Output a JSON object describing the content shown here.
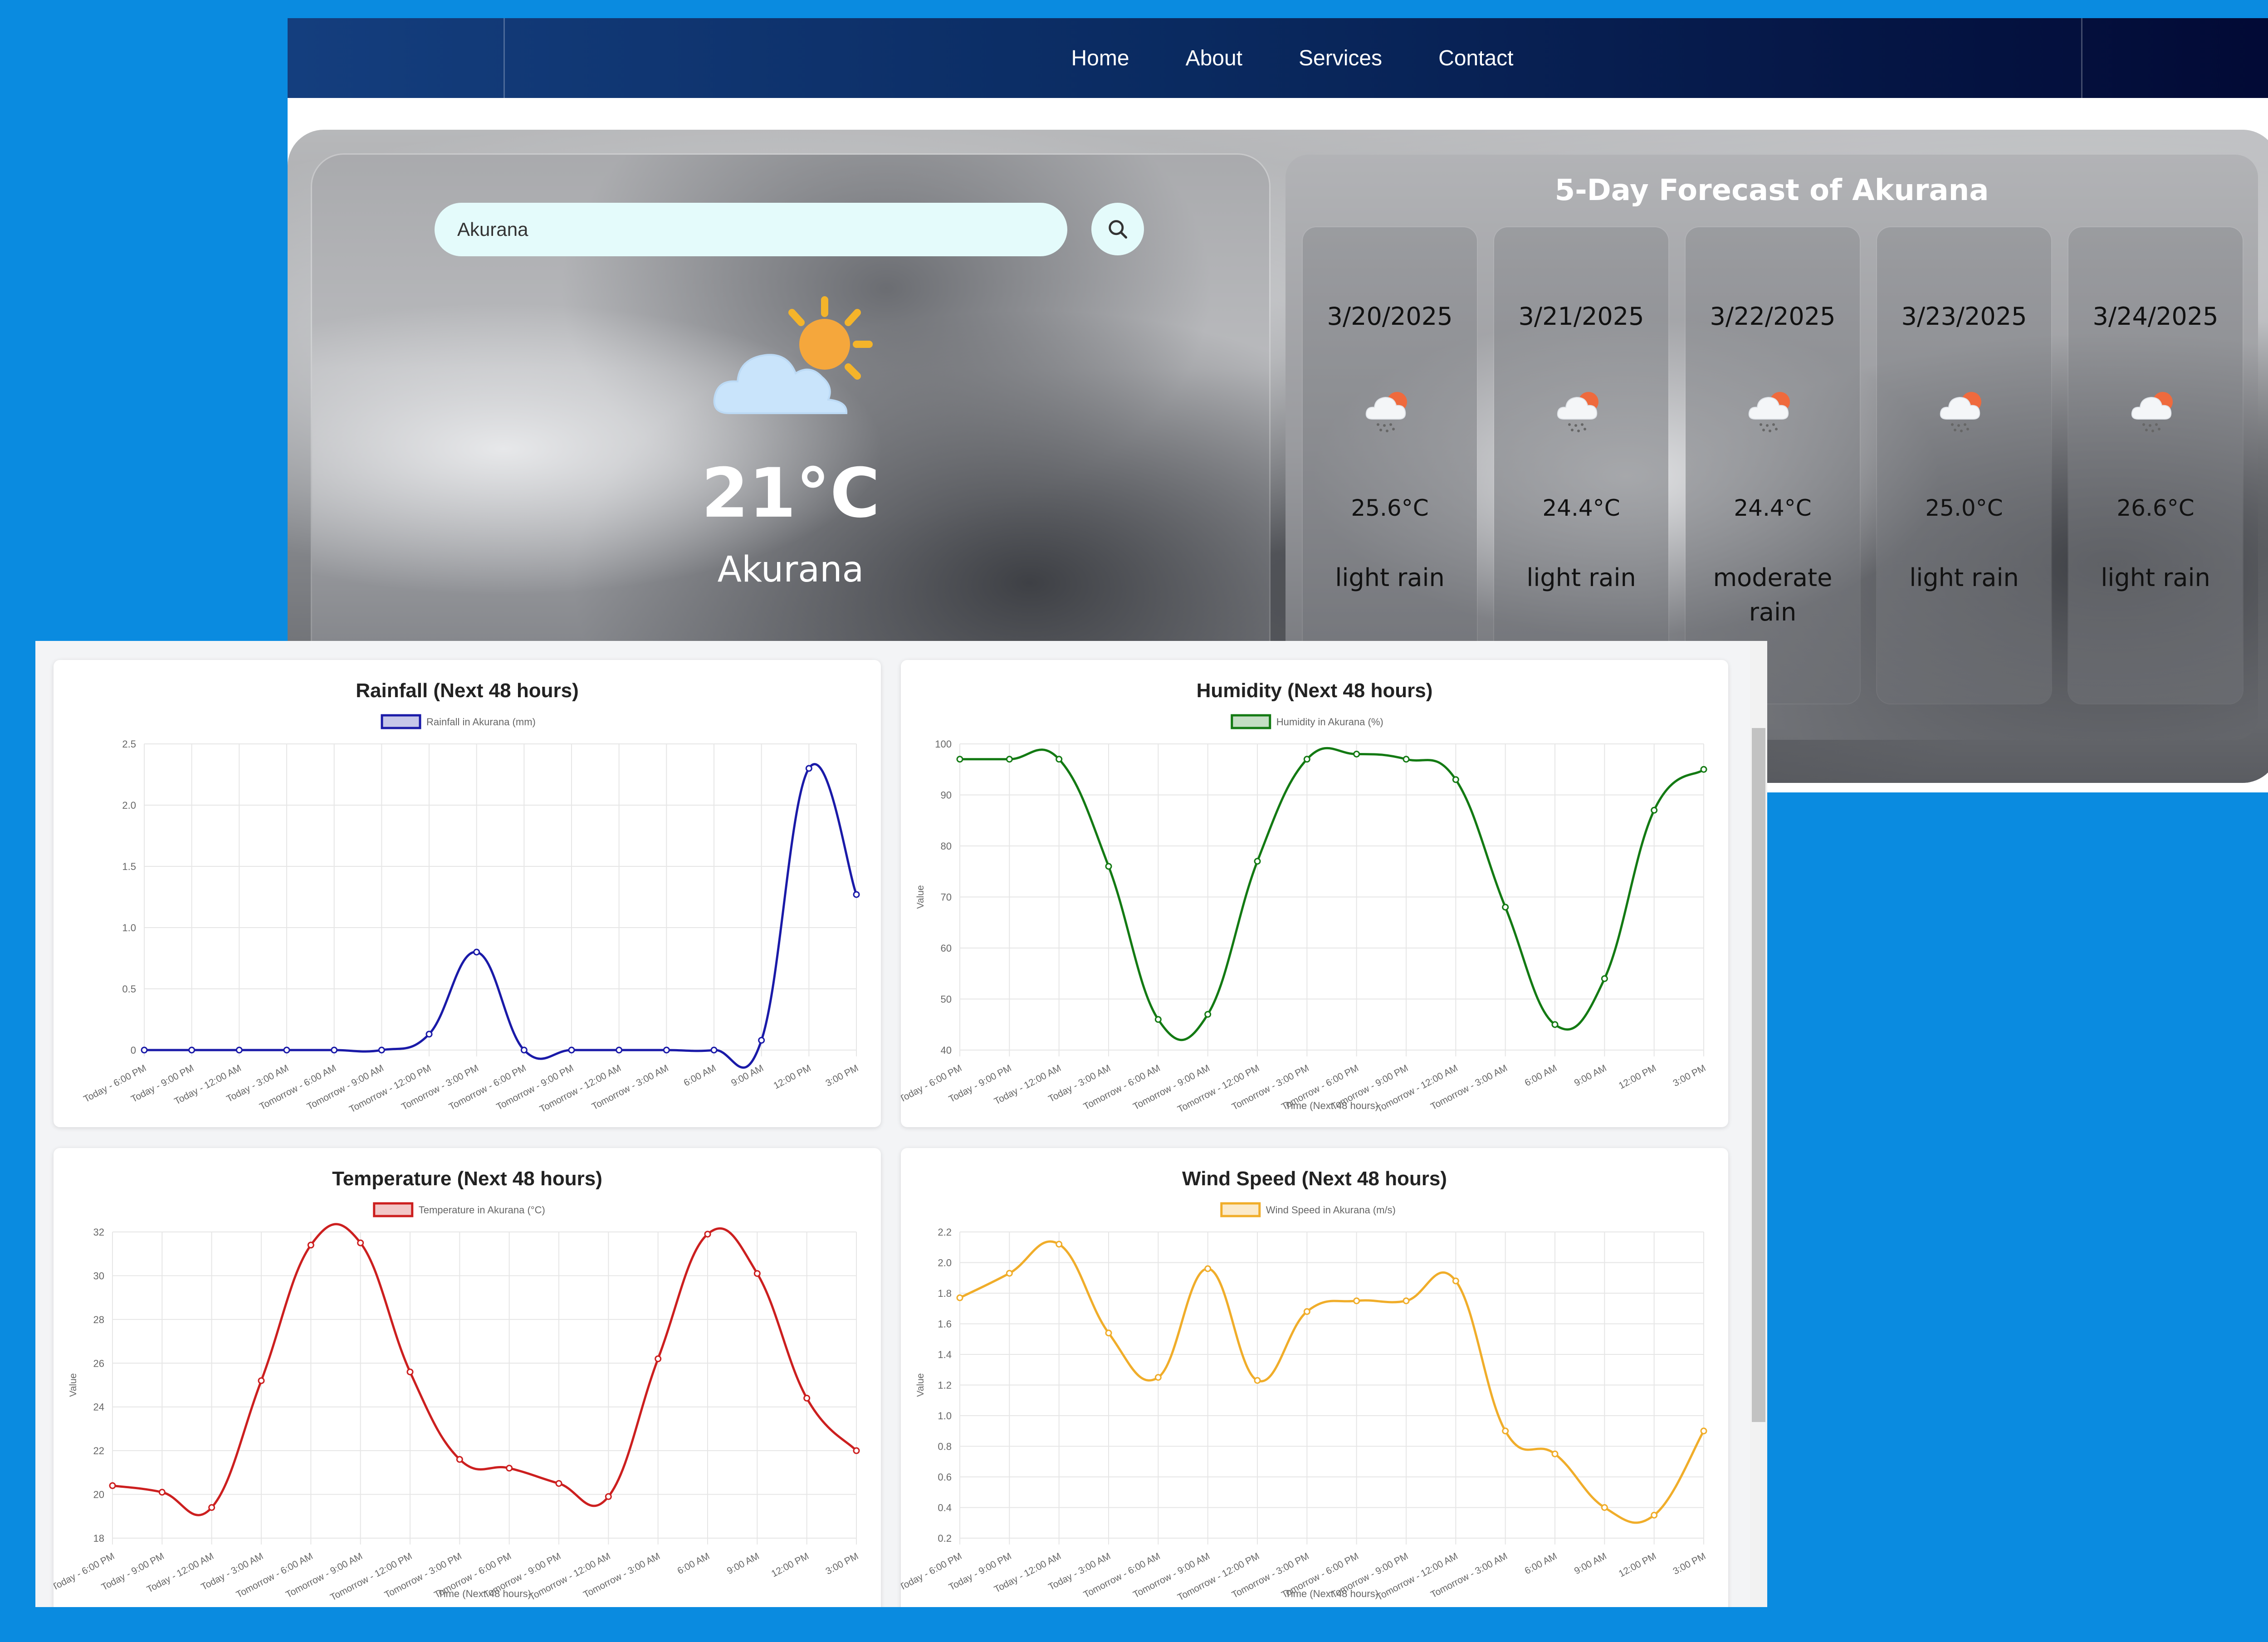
{
  "nav": {
    "links": [
      "Home",
      "About",
      "Services",
      "Contact"
    ]
  },
  "search": {
    "value": "Akurana"
  },
  "current": {
    "temperature": "21°C",
    "city": "Akurana",
    "icon": "sun-behind-cloud-icon"
  },
  "forecast": {
    "title": "5-Day Forecast of Akurana",
    "days": [
      {
        "date": "3/20/2025",
        "temp": "25.6°C",
        "desc": "light rain",
        "icon": "rain-cloud-icon"
      },
      {
        "date": "3/21/2025",
        "temp": "24.4°C",
        "desc": "light rain",
        "icon": "rain-cloud-icon"
      },
      {
        "date": "3/22/2025",
        "temp": "24.4°C",
        "desc": "moderate rain",
        "icon": "rain-cloud-icon"
      },
      {
        "date": "3/23/2025",
        "temp": "25.0°C",
        "desc": "light rain",
        "icon": "rain-cloud-icon"
      },
      {
        "date": "3/24/2025",
        "temp": "26.6°C",
        "desc": "light rain",
        "icon": "rain-cloud-icon"
      }
    ]
  },
  "colors": {
    "rainfall": "#1a1aa8",
    "humidity": "#137a13",
    "temperature": "#cc1f1f",
    "wind": "#f0ad2a"
  },
  "chart_data": [
    {
      "type": "line",
      "title": "Rainfall (Next 48 hours)",
      "categories": [
        "Today - 6:00 PM",
        "Today - 9:00 PM",
        "Today - 12:00 AM",
        "Today - 3:00 AM",
        "Tomorrow - 6:00 AM",
        "Tomorrow - 9:00 AM",
        "Tomorrow - 12:00 PM",
        "Tomorrow - 3:00 PM",
        "Tomorrow - 6:00 PM",
        "Tomorrow - 9:00 PM",
        "Tomorrow - 12:00 AM",
        "Tomorrow - 3:00 AM",
        "6:00 AM",
        "9:00 AM",
        "12:00 PM",
        "3:00 PM"
      ],
      "series": [
        {
          "name": "Rainfall in Akurana (mm)",
          "values": [
            0,
            0,
            0,
            0,
            0,
            0,
            0.13,
            0.8,
            0,
            0,
            0,
            0,
            0,
            0.08,
            2.3,
            1.27
          ]
        }
      ],
      "xlabel": "",
      "ylabel": "",
      "yticks": [
        "0",
        "0.5",
        "1.0",
        "1.5",
        "2.0",
        "2.5"
      ],
      "ylim": [
        0,
        2.5
      ],
      "grid": true,
      "legend": "top"
    },
    {
      "type": "line",
      "title": "Humidity (Next 48 hours)",
      "categories": [
        "Today - 6:00 PM",
        "Today - 9:00 PM",
        "Today - 12:00 AM",
        "Today - 3:00 AM",
        "Tomorrow - 6:00 AM",
        "Tomorrow - 9:00 AM",
        "Tomorrow - 12:00 PM",
        "Tomorrow - 3:00 PM",
        "Tomorrow - 6:00 PM",
        "Tomorrow - 9:00 PM",
        "Tomorrow - 12:00 AM",
        "Tomorrow - 3:00 AM",
        "6:00 AM",
        "9:00 AM",
        "12:00 PM",
        "3:00 PM"
      ],
      "series": [
        {
          "name": "Humidity in Akurana (%)",
          "values": [
            97,
            97,
            97,
            76,
            46,
            47,
            77,
            97,
            98,
            97,
            93,
            68,
            45,
            54,
            87,
            95
          ]
        }
      ],
      "xlabel": "Time (Next 48 hours)",
      "ylabel": "Value",
      "yticks": [
        "40",
        "50",
        "60",
        "70",
        "80",
        "90",
        "100"
      ],
      "ylim": [
        40,
        100
      ],
      "grid": true,
      "legend": "top"
    },
    {
      "type": "line",
      "title": "Temperature (Next 48 hours)",
      "categories": [
        "Today - 6:00 PM",
        "Today - 9:00 PM",
        "Today - 12:00 AM",
        "Today - 3:00 AM",
        "Tomorrow - 6:00 AM",
        "Tomorrow - 9:00 AM",
        "Tomorrow - 12:00 PM",
        "Tomorrow - 3:00 PM",
        "Tomorrow - 6:00 PM",
        "Tomorrow - 9:00 PM",
        "Tomorrow - 12:00 AM",
        "Tomorrow - 3:00 AM",
        "6:00 AM",
        "9:00 AM",
        "12:00 PM",
        "3:00 PM"
      ],
      "series": [
        {
          "name": "Temperature in Akurana (°C)",
          "values": [
            20.4,
            20.1,
            19.4,
            25.2,
            31.4,
            31.5,
            25.6,
            21.6,
            21.2,
            20.5,
            19.9,
            26.2,
            31.9,
            30.1,
            24.4,
            22
          ]
        }
      ],
      "xlabel": "Time (Next 48 hours)",
      "ylabel": "Value",
      "yticks": [
        "18",
        "20",
        "22",
        "24",
        "26",
        "28",
        "30",
        "32"
      ],
      "ylim": [
        18,
        32
      ],
      "grid": true,
      "legend": "top"
    },
    {
      "type": "line",
      "title": "Wind Speed (Next 48 hours)",
      "categories": [
        "Today - 6:00 PM",
        "Today - 9:00 PM",
        "Today - 12:00 AM",
        "Today - 3:00 AM",
        "Tomorrow - 6:00 AM",
        "Tomorrow - 9:00 AM",
        "Tomorrow - 12:00 PM",
        "Tomorrow - 3:00 PM",
        "Tomorrow - 6:00 PM",
        "Tomorrow - 9:00 PM",
        "Tomorrow - 12:00 AM",
        "Tomorrow - 3:00 AM",
        "6:00 AM",
        "9:00 AM",
        "12:00 PM",
        "3:00 PM"
      ],
      "series": [
        {
          "name": "Wind Speed in Akurana (m/s)",
          "values": [
            1.77,
            1.93,
            2.12,
            1.54,
            1.25,
            1.96,
            1.23,
            1.68,
            1.75,
            1.75,
            1.88,
            0.9,
            0.75,
            0.4,
            0.35,
            0.9
          ]
        }
      ],
      "xlabel": "Time (Next 48 hours)",
      "ylabel": "Value",
      "yticks": [
        "0.2",
        "0.4",
        "0.6",
        "0.8",
        "1.0",
        "1.2",
        "1.4",
        "1.6",
        "1.8",
        "2.0",
        "2.2"
      ],
      "ylim": [
        0.2,
        2.2
      ],
      "grid": true,
      "legend": "top"
    }
  ]
}
